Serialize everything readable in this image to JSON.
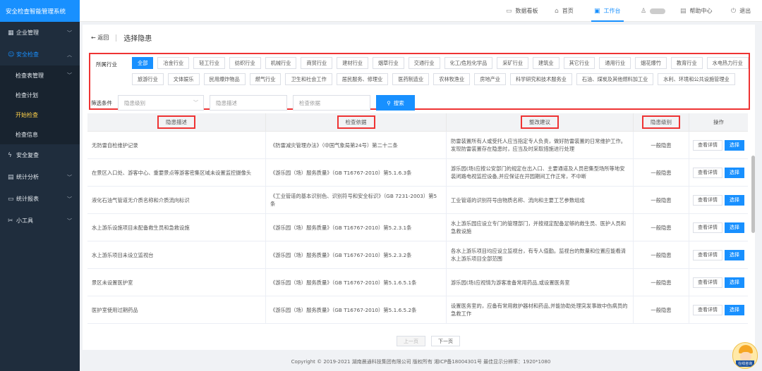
{
  "brand": "安全检查智能管理系统",
  "sidebar": {
    "groups": [
      {
        "label": "企业管理",
        "icon": "building-icon",
        "glyph": "▦"
      },
      {
        "label": "安全检查",
        "icon": "user-check-icon",
        "glyph": "☺"
      },
      {
        "label": "安全复查",
        "icon": "lightning-icon",
        "glyph": "ϟ"
      },
      {
        "label": "统计分析",
        "icon": "bar-chart-icon",
        "glyph": "▤"
      },
      {
        "label": "统计报表",
        "icon": "folder-icon",
        "glyph": "▭"
      },
      {
        "label": "小工具",
        "icon": "tools-icon",
        "glyph": "✂"
      }
    ],
    "subitems": [
      {
        "label": "检查表管理"
      },
      {
        "label": "检查计划"
      },
      {
        "label": "开始检查"
      },
      {
        "label": "检查信息"
      }
    ]
  },
  "header": {
    "items": [
      {
        "label": "数据看板",
        "icon": "monitor-icon",
        "glyph": "▭"
      },
      {
        "label": "首页",
        "icon": "home-icon",
        "glyph": "⌂"
      },
      {
        "label": "工作台",
        "icon": "desktop-icon",
        "glyph": "▣"
      },
      {
        "label": "帮助中心",
        "icon": "help-doc-icon",
        "glyph": "▤"
      },
      {
        "label": "退出",
        "icon": "power-icon",
        "glyph": "⏻"
      }
    ],
    "user_icon": "user-icon"
  },
  "page": {
    "back_label": "← 返回",
    "title": "选择隐患"
  },
  "industry": {
    "label": "所属行业",
    "row1": [
      "全部",
      "冶金行业",
      "轻工行业",
      "纺织行业",
      "机械行业",
      "商贸行业",
      "建材行业",
      "烟草行业",
      "交通行业",
      "化工/危险化学品",
      "采矿行业",
      "建筑业",
      "其它行业",
      "通用行业",
      "烟花爆竹",
      "教育行业",
      "水电热力行业"
    ],
    "row2": [
      "旅游行业",
      "文体娱乐",
      "民用爆炸物品",
      "燃气行业",
      "卫生和社会工作",
      "居民服务、修理业",
      "医药制造业",
      "农林牧渔业",
      "房地产业",
      "科学研究和技术服务业",
      "石油、煤炭及其他燃料加工业",
      "水利、环境和公共设施管理业"
    ]
  },
  "filter": {
    "label": "筛选条件",
    "level_placeholder": "隐患级别",
    "desc_placeholder": "隐患描述",
    "basis_placeholder": "检查依据",
    "search_label": "搜索"
  },
  "table": {
    "headers": [
      "隐患描述",
      "检查依据",
      "整改建议",
      "隐患级别",
      "操作"
    ],
    "detail_label": "查看详情",
    "choose_label": "选择",
    "rows": [
      {
        "desc": "无防雷自检维护记录",
        "basis": "《防雷减灾管理办法》（中国气象局第24号）第二十二条",
        "advice": "防雷装置所有人或受托人应当指定专人负责，做好防雷装置的日常维护工作。发现防雷装置存在隐患时，应当及时采取措施进行处理",
        "level": "一般隐患"
      },
      {
        "desc": "在景区入口处、游客中心、重要景点等游客密集区域未设置监控摄像头",
        "basis": "《游乐园（场）服务质量》（GB T16767-2010）第5.1.6.3条",
        "advice": "游乐园(场)应按公安部门的规定在出入口、主要通道及人员密集型场所等地安装闭路电视监控设备,并应保证在开园期间工作正常，不中断",
        "level": "一般隐患"
      },
      {
        "desc": "液化石油气管道无介质名称和介质流向标识",
        "basis": "《工业管道的基本识别色、识别符号和安全标识》（GB 7231-2003）第5条",
        "advice": "工业管道的识别符号由物质名称、流向和主要工艺参数组成",
        "level": "一般隐患"
      },
      {
        "desc": "水上游乐设施项目未配备救生员和急救设施",
        "basis": "《游乐园（场）服务质量》（GB T16767-2010）第5.2.3.1条",
        "advice": "水上游乐园应设立专门的管理部门，并按规定配备足够的救生员、医护人员和急救设施",
        "level": "一般隐患"
      },
      {
        "desc": "水上游乐项目未设立监视台",
        "basis": "《游乐园（场）服务质量》（GB T16767-2010）第5.2.3.2条",
        "advice": "各水上游乐项目均应设立监视台，有专人值勤。监视台的数量和位置应能看清水上游乐项目全部范围",
        "level": "一般隐患"
      },
      {
        "desc": "景区未设置医护室",
        "basis": "《游乐园（场）服务质量》（GB T16767-2010）第5.1.6.5.1条",
        "advice": "游乐园(场)应视情为游客准备常用药品,或设置医务室",
        "level": "一般隐患"
      },
      {
        "desc": "医护室使用过期药品",
        "basis": "《游乐园（场）服务质量》（GB T16767-2010）第5.1.6.5.2条",
        "advice": "设置医务室的，应备有常用救护器材和药品,并能协助处理突发事故中伤病员的急救工作",
        "level": "一般隐患"
      }
    ]
  },
  "pager": {
    "prev": "上一页",
    "next": "下一页"
  },
  "footer": "Copyright © 2019-2021 湖南晨通科技集团有限公司 版权所有 湘ICP备18004301号 最佳显示分辨率：1920*1080",
  "mascot_badge": "在线咨询"
}
